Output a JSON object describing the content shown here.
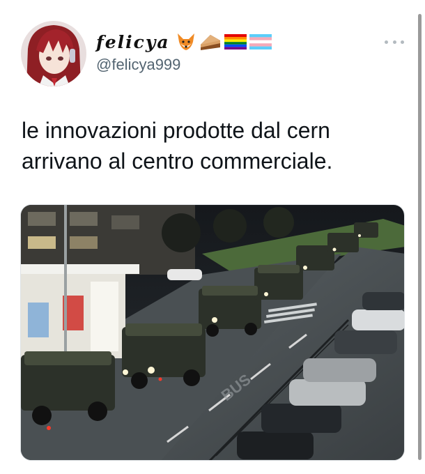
{
  "tweet": {
    "display_name": "felicya",
    "handle": "@felicya999",
    "text": "le innovazioni prodotte dal cern\narrivano al centro commerciale.",
    "name_emojis": [
      "fox-face-icon",
      "pie-slice-icon",
      "pride-flag-icon",
      "transgender-flag-icon"
    ]
  },
  "media": {
    "description_icon": "photo-of-military-trucks-at-night",
    "road_marking": "BUS"
  },
  "colors": {
    "text": "#0f1419",
    "handle": "#536471",
    "background": "#ffffff"
  }
}
